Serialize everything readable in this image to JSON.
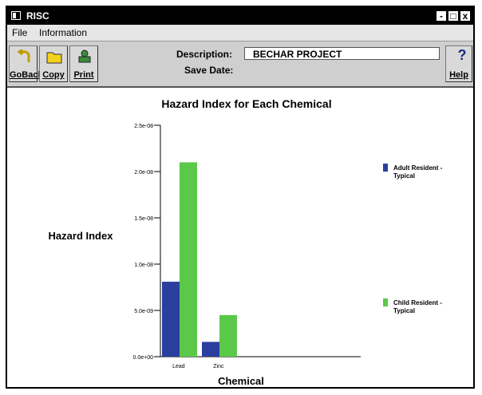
{
  "window": {
    "title": "RISC",
    "minimize_label": "-",
    "restore_label": "□",
    "close_label": "x"
  },
  "menu": {
    "file": "File",
    "information": "Information"
  },
  "toolbar": {
    "goback_label": "GoBack",
    "copy_label": "Copy",
    "print_label": "Print",
    "help_label": "Help",
    "help_glyph": "?",
    "description_label": "Description:",
    "description_value": "BECHAR PROJECT",
    "save_date_label": "Save Date:",
    "save_date_value": ""
  },
  "colors": {
    "adult": "#2b3f9e",
    "child": "#5cc84a"
  },
  "icons": {
    "goback": "back-arrow-icon",
    "copy": "folder-icon",
    "print": "printer-icon",
    "help": "question-icon"
  },
  "chart_data": {
    "type": "bar",
    "title": "Hazard Index for Each Chemical",
    "xlabel": "Chemical",
    "ylabel": "Hazard Index",
    "categories": [
      "Lead",
      "Zinc"
    ],
    "series": [
      {
        "name": "Adult Resident - Typical",
        "values": [
          8.1e-09,
          1.6e-09
        ],
        "color": "#2b3f9e"
      },
      {
        "name": "Child Resident - Typical",
        "values": [
          2.1e-08,
          4.5e-09
        ],
        "color": "#5cc84a"
      }
    ],
    "ylim": [
      0,
      2.5e-08
    ],
    "yticks": [
      0,
      5e-09,
      1e-08,
      1.5e-08,
      2e-08,
      2.5e-08
    ],
    "ytick_labels": [
      "0.0e+00",
      "5.0e-09",
      "1.0e-08",
      "1.5e-08",
      "2.0e-08",
      "2.5e-08"
    ],
    "grid": false,
    "legend": "right"
  }
}
